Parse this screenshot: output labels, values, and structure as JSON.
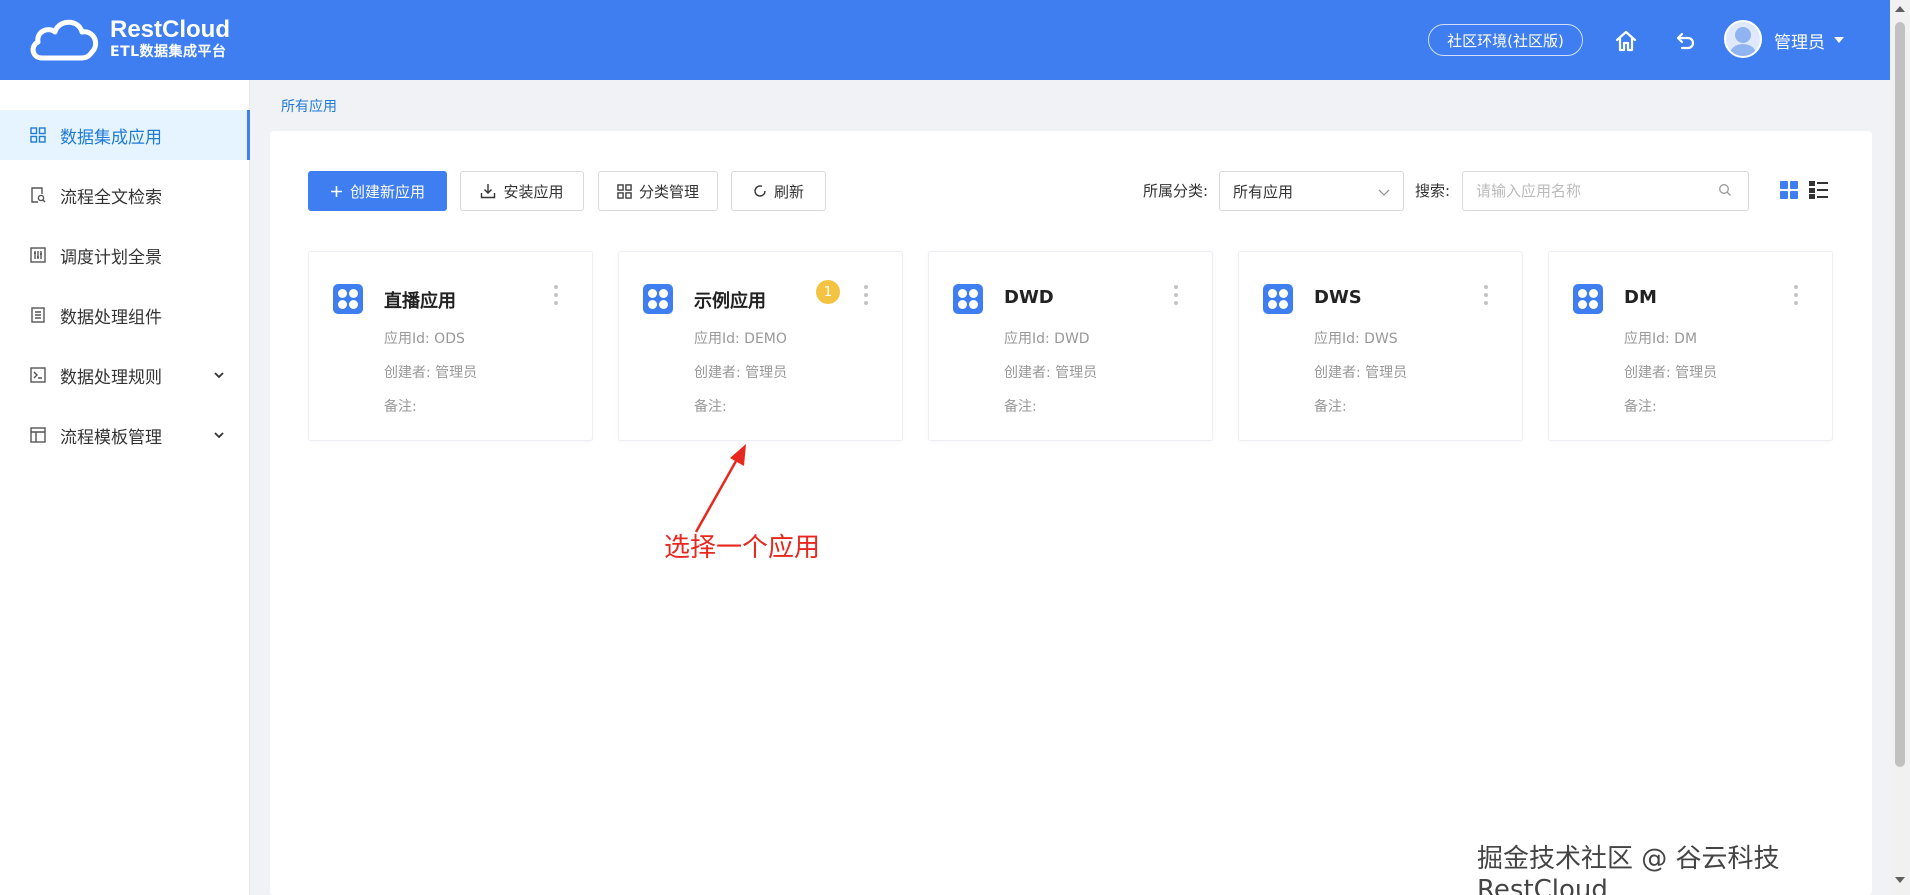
{
  "header": {
    "logo_title": "RestCloud",
    "logo_subtitle": "ETL数据集成平台",
    "env_label": "社区环境(社区版)",
    "home_icon": "home-icon",
    "back_icon": "undo-icon",
    "user_name": "管理员"
  },
  "sidebar": {
    "items": [
      {
        "label": "数据集成应用",
        "icon": "grid-icon",
        "active": true
      },
      {
        "label": "流程全文检索",
        "icon": "doc-search-icon"
      },
      {
        "label": "调度计划全景",
        "icon": "sliders-icon"
      },
      {
        "label": "数据处理组件",
        "icon": "list-icon"
      },
      {
        "label": "数据处理规则",
        "icon": "terminal-icon",
        "expandable": true
      },
      {
        "label": "流程模板管理",
        "icon": "layout-icon",
        "expandable": true
      }
    ]
  },
  "breadcrumb": "所有应用",
  "toolbar": {
    "create_label": "创建新应用",
    "install_label": "安装应用",
    "category_label": "分类管理",
    "refresh_label": "刷新",
    "category_filter_label": "所属分类:",
    "category_filter_value": "所有应用",
    "search_label": "搜索:",
    "search_placeholder": "请输入应用名称"
  },
  "apps": [
    {
      "name": "直播应用",
      "app_id": "应用Id: ODS",
      "creator": "创建者: 管理员",
      "note": "备注:"
    },
    {
      "name": "示例应用",
      "app_id": "应用Id: DEMO",
      "creator": "创建者: 管理员",
      "note": "备注:",
      "badge": "1"
    },
    {
      "name": "DWD",
      "app_id": "应用Id: DWD",
      "creator": "创建者: 管理员",
      "note": "备注:"
    },
    {
      "name": "DWS",
      "app_id": "应用Id: DWS",
      "creator": "创建者: 管理员",
      "note": "备注:"
    },
    {
      "name": "DM",
      "app_id": "应用Id: DM",
      "creator": "创建者: 管理员",
      "note": "备注:"
    }
  ],
  "annotation": "选择一个应用",
  "watermark": "掘金技术社区 @ 谷云科技RestCloud",
  "colors": {
    "brand": "#3f7ef0",
    "active_text": "#1f7ad8",
    "annotation": "#e8281e",
    "badge": "#f5c342"
  }
}
